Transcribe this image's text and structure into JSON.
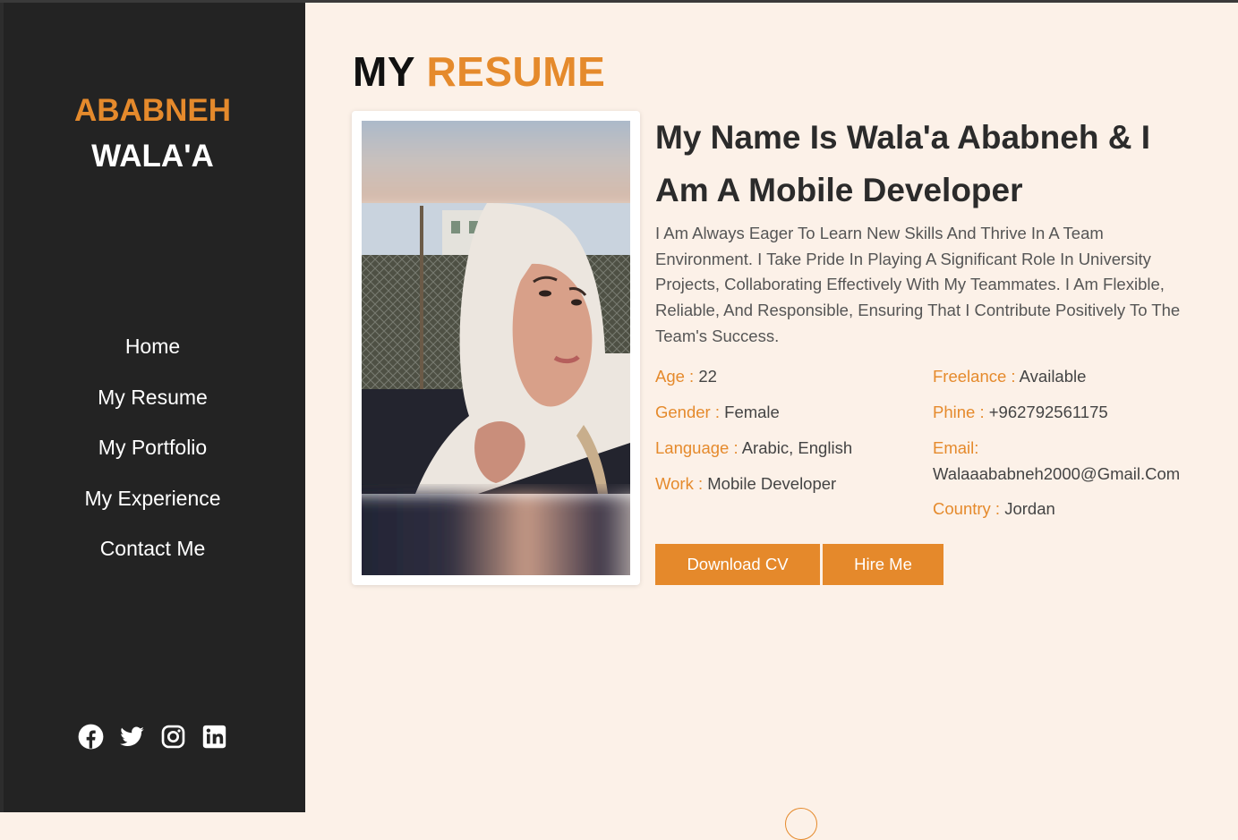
{
  "brand": {
    "first": "ABABNEH",
    "last": "WALA'A"
  },
  "nav": {
    "items": [
      {
        "label": "Home"
      },
      {
        "label": "My Resume"
      },
      {
        "label": "My Portfolio"
      },
      {
        "label": "My Experience"
      },
      {
        "label": "Contact Me"
      }
    ]
  },
  "socials": {
    "icons": [
      "facebook-icon",
      "twitter-icon",
      "instagram-icon",
      "linkedin-icon"
    ]
  },
  "resume": {
    "title_word1": "MY",
    "title_word2": "RESUME",
    "headline": "My Name Is Wala'a Ababneh & I Am A Mobile Developer",
    "description": "I Am Always Eager To Learn New Skills And Thrive In A Team Environment. I Take Pride In Playing A Significant Role In University Projects, Collaborating Effectively With My Teammates. I Am Flexible, Reliable, And Responsible, Ensuring That I Contribute Positively To The Team's Success.",
    "info_left": [
      {
        "key": "Age :",
        "value": " 22"
      },
      {
        "key": "Gender :",
        "value": " Female"
      },
      {
        "key": "Language :",
        "value": " Arabic, English"
      },
      {
        "key": "Work :",
        "value": " Mobile Developer"
      }
    ],
    "info_right": [
      {
        "key": "Freelance :",
        "value": " Available"
      },
      {
        "key": "Phine :",
        "value": " +962792561175"
      },
      {
        "key": "Email:",
        "value": "Walaaababneh2000@Gmail.Com"
      },
      {
        "key": "Country :",
        "value": " Jordan"
      }
    ],
    "download_label": "Download CV",
    "hire_label": "Hire Me"
  },
  "colors": {
    "accent": "#e58a2c",
    "sidebar": "#232323",
    "background": "#fcf1e8"
  }
}
